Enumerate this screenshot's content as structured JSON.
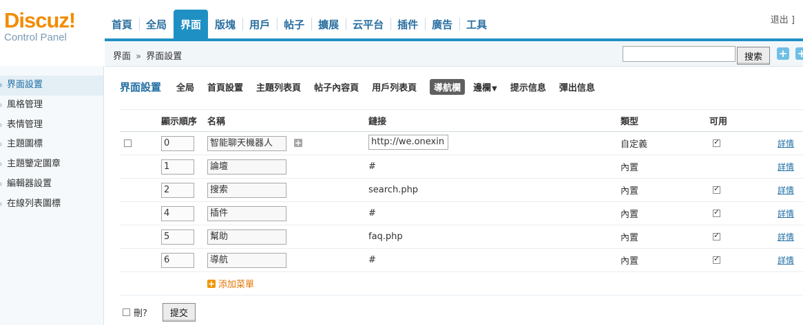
{
  "logo": {
    "main": "Discuz",
    "bang": "!",
    "sub": "Control Panel"
  },
  "topnav": [
    "首頁",
    "全局",
    "界面",
    "版塊",
    "用戶",
    "帖子",
    "擴展",
    "云平台",
    "插件",
    "廣告",
    "工具"
  ],
  "topnav_active": "界面",
  "logout": "退出 ]",
  "breadcrumb": {
    "root": "界面",
    "sep": "»",
    "current": "界面設置"
  },
  "search": {
    "value": "",
    "button": "搜索"
  },
  "sidebar": [
    "界面設置",
    "風格管理",
    "表情管理",
    "主題圖標",
    "主題鑒定圖章",
    "編輯器設置",
    "在線列表圖標"
  ],
  "sidebar_active": "界面設置",
  "subnav": {
    "title": "界面設置",
    "items": [
      "全局",
      "首頁設置",
      "主題列表頁",
      "帖子內容頁",
      "用戶列表頁",
      "導航欄",
      "邊欄",
      "提示信息",
      "彈出信息"
    ],
    "active": "導航欄",
    "dropdown_item": "邊欄",
    "caret": "▼"
  },
  "table": {
    "headers": {
      "order": "顯示順序",
      "name": "名稱",
      "url": "鏈接",
      "type": "類型",
      "available": "可用"
    },
    "rows": [
      {
        "order": "0",
        "name": "智能聊天機器人",
        "url": "http://we.onexin",
        "type": "自定義",
        "available": true,
        "editable": true,
        "detail": "詳情"
      },
      {
        "order": "1",
        "name": "論壇",
        "url": "#",
        "type": "內置",
        "available": false,
        "editable": false,
        "detail": "詳情"
      },
      {
        "order": "2",
        "name": "搜索",
        "url": "search.php",
        "type": "內置",
        "available": true,
        "editable": false,
        "detail": "詳情"
      },
      {
        "order": "4",
        "name": "插件",
        "url": "#",
        "type": "內置",
        "available": true,
        "editable": false,
        "detail": "詳情"
      },
      {
        "order": "5",
        "name": "幫助",
        "url": "faq.php",
        "type": "內置",
        "available": true,
        "editable": false,
        "detail": "詳情"
      },
      {
        "order": "6",
        "name": "導航",
        "url": "#",
        "type": "內置",
        "available": true,
        "editable": false,
        "detail": "詳情"
      }
    ],
    "add_menu": "添加菜單"
  },
  "footer": {
    "delete_label": "刪?",
    "submit": "提交"
  },
  "colors": {
    "brand_orange": "#f28c00",
    "nav_blue": "#1f90c4",
    "link_blue": "#1f6ea3"
  }
}
